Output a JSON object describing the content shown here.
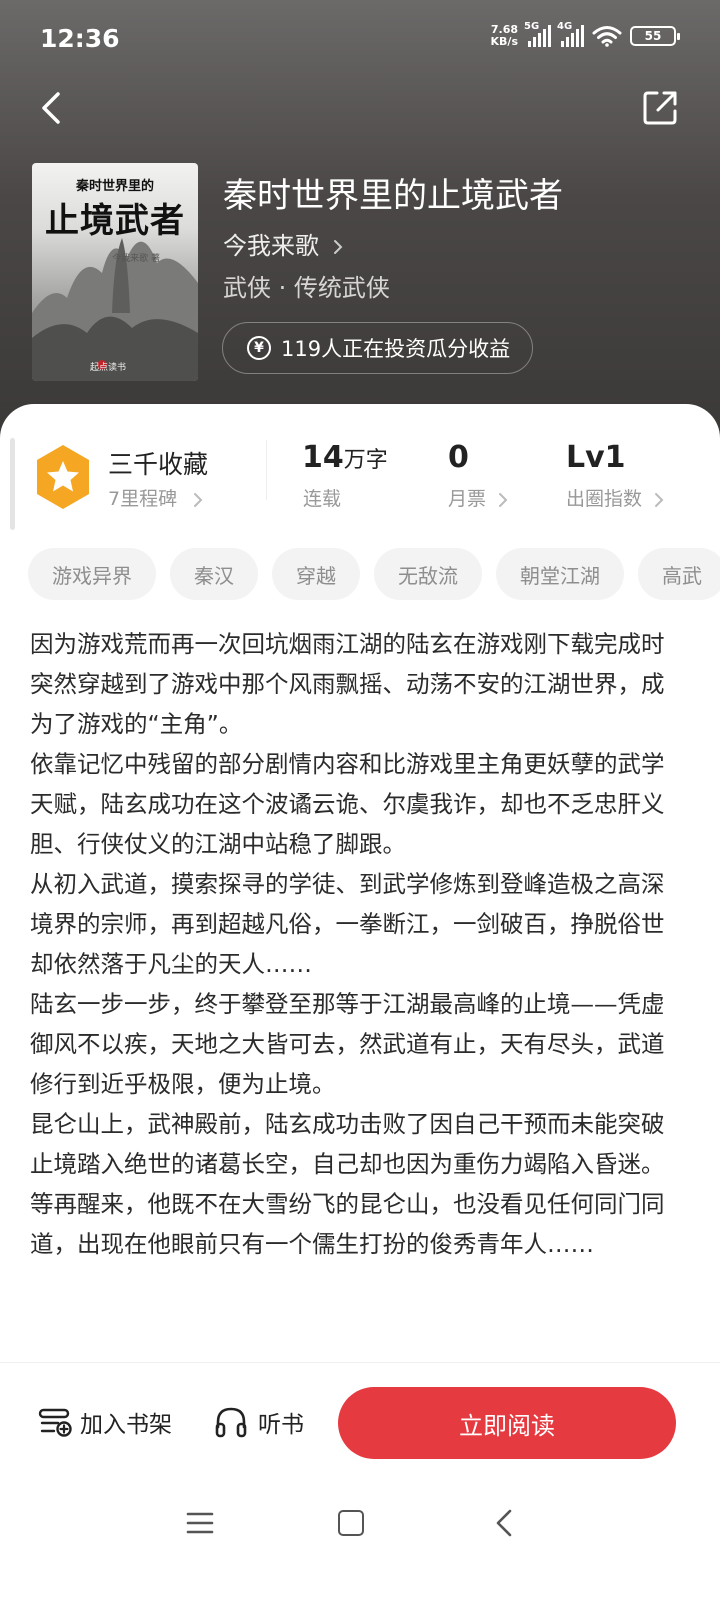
{
  "status_bar": {
    "time": "12:36",
    "net_speed_value": "7.68",
    "net_speed_unit": "KB/s",
    "sig1_label": "5G",
    "sig2_label": "4G",
    "battery": "55"
  },
  "header": {
    "back_icon": "chevron-left-icon",
    "share_icon": "share-icon"
  },
  "book": {
    "cover_subtitle": "秦时世界里的",
    "cover_title": "止境武者",
    "cover_author": "今我来歌 著",
    "cover_publisher": "起点读书",
    "title": "秦时世界里的止境武者",
    "author": "今我来歌",
    "genre": "武侠 · 传统武侠",
    "invest_text": "119人正在投资瓜分收益",
    "invest_icon": "yen-icon"
  },
  "stats": {
    "favorites": {
      "label": "三千收藏",
      "sub": "7里程碑"
    },
    "words": {
      "value": "14",
      "unit": "万字",
      "label": "连载"
    },
    "monthly_ticket": {
      "value": "0",
      "label": "月票"
    },
    "influence": {
      "value": "Lv1",
      "label": "出圈指数"
    }
  },
  "tags": [
    "游戏异界",
    "秦汉",
    "穿越",
    "无敌流",
    "朝堂江湖",
    "高武"
  ],
  "synopsis": [
    "因为游戏荒而再一次回坑烟雨江湖的陆玄在游戏刚下载完成时突然穿越到了游戏中那个风雨飘摇、动荡不安的江湖世界，成为了游戏的“主角”。",
    "依靠记忆中残留的部分剧情内容和比游戏里主角更妖孽的武学天赋，陆玄成功在这个波谲云诡、尔虞我诈，却也不乏忠肝义胆、行侠仗义的江湖中站稳了脚跟。",
    "从初入武道，摸索探寻的学徒、到武学修炼到登峰造极之高深境界的宗师，再到超越凡俗，一拳断江，一剑破百，挣脱俗世却依然落于凡尘的天人……",
    "陆玄一步一步，终于攀登至那等于江湖最高峰的止境——凭虚御风不以疾，天地之大皆可去，然武道有止，天有尽头，武道修行到近乎极限，便为止境。",
    "昆仑山上，武神殿前，陆玄成功击败了因自己干预而未能突破止境踏入绝世的诸葛长空，自己却也因为重伤力竭陷入昏迷。",
    "等再醒来，他既不在大雪纷飞的昆仑山，也没看见任何同门同道，出现在他眼前只有一个儒生打扮的俊秀青年人……"
  ],
  "bottom": {
    "shelf_label": "加入书架",
    "listen_label": "听书",
    "read_label": "立即阅读"
  },
  "colors": {
    "accent": "#e63a41",
    "badge": "#f5a623"
  }
}
